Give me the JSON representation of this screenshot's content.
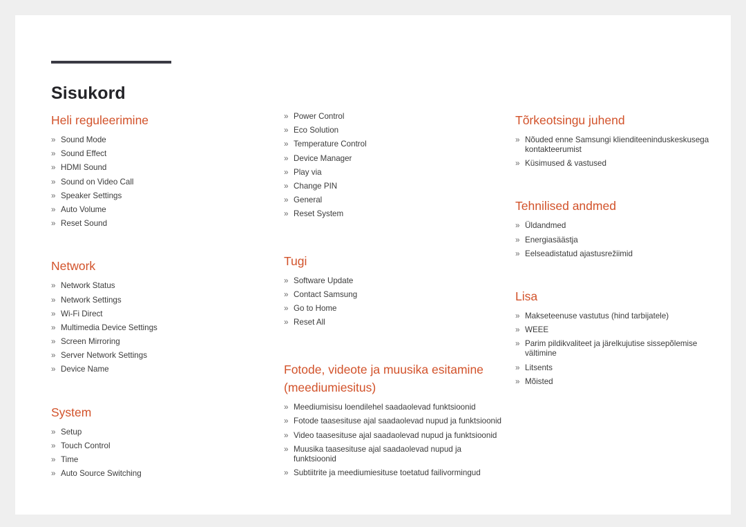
{
  "document": {
    "title": "Sisukord",
    "bullet_glyph": "»",
    "accent_color": "#d2522a",
    "rule_color": "#3a3a44",
    "text_color": "#3b3b3b",
    "page_background": "#ffffff",
    "canvas_background": "#efefef"
  },
  "columns": [
    {
      "id": "column-1",
      "sections": [
        {
          "id": "heli-reguleerimine",
          "heading": "Heli reguleerimine",
          "items": [
            "Sound Mode",
            "Sound Effect",
            "HDMI Sound",
            "Sound on Video Call",
            "Speaker Settings",
            "Auto Volume",
            "Reset Sound"
          ]
        },
        {
          "id": "network",
          "heading": "Network",
          "items": [
            "Network Status",
            "Network Settings",
            "Wi-Fi Direct",
            "Multimedia Device Settings",
            "Screen Mirroring",
            "Server Network Settings",
            "Device Name"
          ]
        },
        {
          "id": "system",
          "heading": "System",
          "items": [
            "Setup",
            "Touch Control",
            "Time",
            "Auto Source Switching"
          ]
        }
      ]
    },
    {
      "id": "column-2",
      "sections": [
        {
          "id": "system-continued",
          "heading": "",
          "items": [
            "Power Control",
            "Eco Solution",
            "Temperature Control",
            "Device Manager",
            "Play via",
            "Change PIN",
            "General",
            "Reset System"
          ]
        },
        {
          "id": "tugi",
          "heading": "Tugi",
          "items": [
            "Software Update",
            "Contact Samsung",
            "Go to Home",
            "Reset All"
          ]
        },
        {
          "id": "meediumiesitus",
          "heading": "Fotode, videote ja muusika esitamine (meediumiesitus)",
          "items": [
            "Meediumisisu loendilehel saadaolevad funktsioonid",
            "Fotode taasesituse ajal saadaolevad nupud ja funktsioonid",
            "Video taasesituse ajal saadaolevad nupud ja funktsioonid",
            "Muusika taasesituse ajal saadaolevad nupud ja funktsioonid",
            "Subtiitrite ja meediumiesituse toetatud failivormingud"
          ]
        }
      ]
    },
    {
      "id": "column-3",
      "sections": [
        {
          "id": "torkeotsingu-juhend",
          "heading": "Tõrkeotsingu juhend",
          "items": [
            "Nõuded enne Samsungi klienditeeninduskeskusega kontakteerumist",
            "Küsimused & vastused"
          ]
        },
        {
          "id": "tehnilised-andmed",
          "heading": "Tehnilised andmed",
          "items": [
            "Üldandmed",
            "Energiasäästja",
            "Eelseadistatud ajastusrežiimid"
          ]
        },
        {
          "id": "lisa",
          "heading": "Lisa",
          "items": [
            "Makseteenuse vastutus (hind tarbijatele)",
            "WEEE",
            "Parim pildikvaliteet ja järelkujutise sissepõlemise vältimine",
            "Litsents",
            "Mõisted"
          ]
        }
      ]
    }
  ]
}
